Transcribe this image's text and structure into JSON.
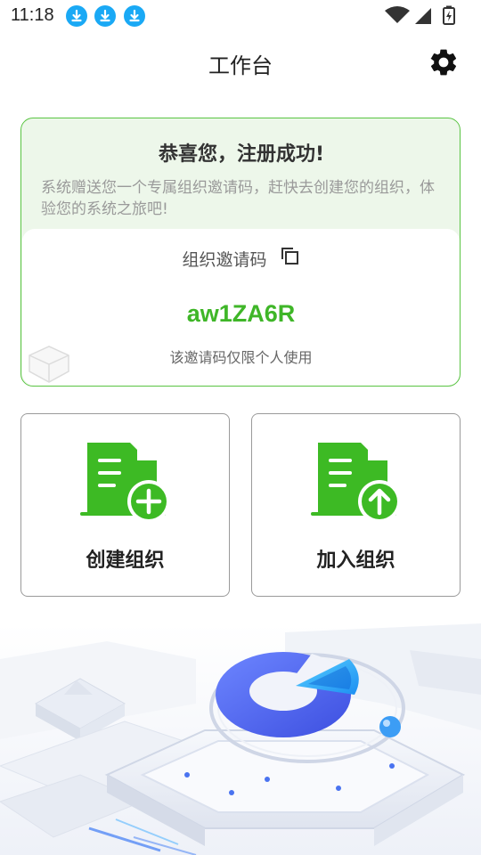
{
  "status_bar": {
    "time": "11:18",
    "download_icon_color": "#1aa9f5",
    "icons": [
      "download-icon",
      "download-icon",
      "download-icon",
      "wifi-icon",
      "signal-icon",
      "battery-charging-icon"
    ]
  },
  "header": {
    "title": "工作台",
    "settings_icon": "gear-icon"
  },
  "invite_card": {
    "title": "恭喜您，注册成功!",
    "description": "系统赠送您一个专属组织邀请码，赶快去创建您的组织，体验您的系统之旅吧!",
    "code_label": "组织邀请码",
    "copy_icon": "copy-icon",
    "code": "aw1ZA6R",
    "note": "该邀请码仅限个人使用"
  },
  "actions": {
    "create": {
      "label": "创建组织",
      "icon": "building-add-icon"
    },
    "join": {
      "label": "加入组织",
      "icon": "building-upload-icon"
    }
  },
  "colors": {
    "accent_green": "#3fb628",
    "card_border": "#59c442",
    "card_bg": "#edf7ea",
    "hero_blue": "#4b6cf2"
  }
}
